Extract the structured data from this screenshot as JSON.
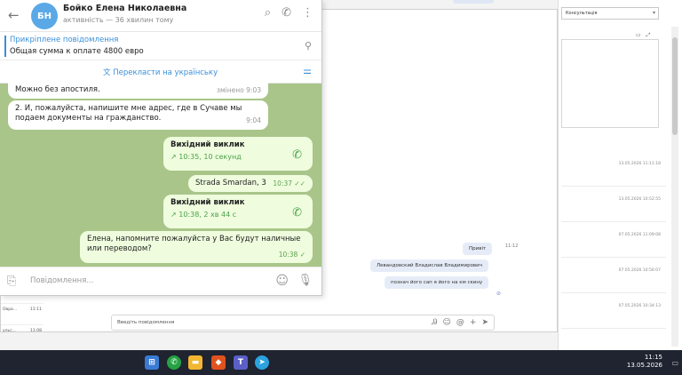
{
  "background": {
    "select_value": "Консультація",
    "dates": [
      "13.05.2026 11:11:18",
      "13.05.2026 10:52:55",
      "07.05.2026 11:09:08",
      "07.05.2026 10:56:07",
      "07.05.2026 10:34:13"
    ]
  },
  "crm": {
    "left_list": [
      {
        "name": "Овра...",
        "time": "11:11"
      },
      {
        "name": "ульс...",
        "time": "11:08"
      }
    ],
    "time_label": "11:12",
    "messages": [
      "Привіт",
      "Левандовский Владислав Владимирович",
      "познач його сап я його на км скину"
    ],
    "input_placeholder": "Введіть повідомлення"
  },
  "telegram": {
    "avatar_initials": "БН",
    "contact_name": "Бойко Елена Николаевна",
    "contact_status": "активність — 36 хвилин тому",
    "pinned_title": "Прикріплене повідомлення",
    "pinned_text": "Общая сумма к оплате 4800 евро",
    "translate_label": "Перекласти на українську",
    "messages": [
      {
        "text": "Можно без апостиля.",
        "time": "змінено 9:03"
      },
      {
        "text": "2. И, пожалуйста, напишите мне адрес, где в Сучаве мы подаем документы на гражданство.",
        "time": "9:04"
      },
      {
        "call_title": "Вихідний виклик",
        "call_detail": "10:35, 10 секунд"
      },
      {
        "text": "Strada Smardan, 3",
        "time": "10:37"
      },
      {
        "call_title": "Вихідний виклик",
        "call_detail": "10:38, 2 хв 44 с"
      },
      {
        "text": "Елена, напомните пожалуйста у Вас будут наличные или переводом?",
        "time": "10:38"
      }
    ],
    "input_placeholder": "Повідомлення..."
  },
  "taskbar": {
    "time": "11:15",
    "date": "13.05.2026"
  }
}
